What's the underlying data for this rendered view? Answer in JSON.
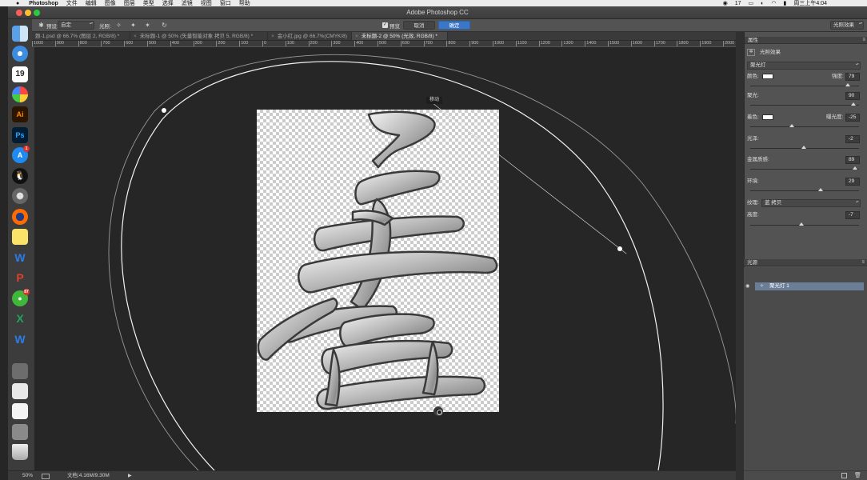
{
  "menubar": {
    "app": "Photoshop",
    "items": [
      "文件",
      "编辑",
      "图像",
      "图层",
      "类型",
      "选择",
      "滤镜",
      "视图",
      "窗口",
      "帮助"
    ],
    "badge": "17",
    "clock": "周三上午4:04"
  },
  "window": {
    "title": "Adobe Photoshop CC"
  },
  "options": {
    "preset_label": "预设:",
    "preset_value": "自定",
    "light_label": "光照:",
    "preview_label": "预览",
    "preview_checked": true,
    "cancel_label": "取消",
    "ok_label": "确定",
    "workspace_value": "光照效果"
  },
  "dock": {
    "calendar_day": "19",
    "appstore_badge": "1",
    "wechat_badge": "87",
    "ai_label": "Ai",
    "ps_label": "Ps"
  },
  "tabs": [
    {
      "label": "题-1.psd @ 66.7% (图层 2, RGB/8) *",
      "active": false,
      "closable": false
    },
    {
      "label": "未标题-1 @ 50% (矢量智能对象 拷贝 5, RGB/8) *",
      "active": false,
      "closable": true
    },
    {
      "label": "金小红.jpg @ 66.7%(CMYK/8)",
      "active": false,
      "closable": true
    },
    {
      "label": "未标题-2 @ 50% (光效, RGB/8) *",
      "active": true,
      "closable": true
    }
  ],
  "ruler": {
    "ticks": [
      "1000",
      "900",
      "800",
      "700",
      "600",
      "500",
      "400",
      "300",
      "200",
      "100",
      "0",
      "100",
      "200",
      "300",
      "400",
      "500",
      "600",
      "700",
      "800",
      "900",
      "1000",
      "1100",
      "1200",
      "1300",
      "1400",
      "1500",
      "1600",
      "1700",
      "1800",
      "1900",
      "2000",
      "210"
    ]
  },
  "canvas": {
    "move_tooltip": "移动"
  },
  "status": {
    "zoom": "50%",
    "doc_size": "文档:4.16M/9.30M"
  },
  "properties": {
    "panel_title": "属性",
    "section_title": "光照效果",
    "light_type": "聚光灯",
    "color_label": "颜色:",
    "intensity_label": "强度:",
    "intensity": "79",
    "hotspot_label": "聚光:",
    "hotspot": "90",
    "colorize_label": "着色:",
    "exposure_label": "曝光度:",
    "exposure": "-25",
    "gloss_label": "光泽:",
    "gloss": "-2",
    "metallic_label": "金属质感:",
    "metallic": "89",
    "ambience_label": "环境:",
    "ambience": "29",
    "texture_label": "纹理:",
    "texture_value": "蓝 拷贝",
    "height_label": "高度:",
    "height": "-7",
    "slider_positions": {
      "intensity": 0.9,
      "hotspot": 0.95,
      "exposure": 0.38,
      "gloss": 0.49,
      "metallic": 0.96,
      "ambience": 0.65,
      "height": 0.47
    }
  },
  "lights": {
    "panel_title": "光源",
    "items": [
      "聚光灯 1"
    ]
  }
}
